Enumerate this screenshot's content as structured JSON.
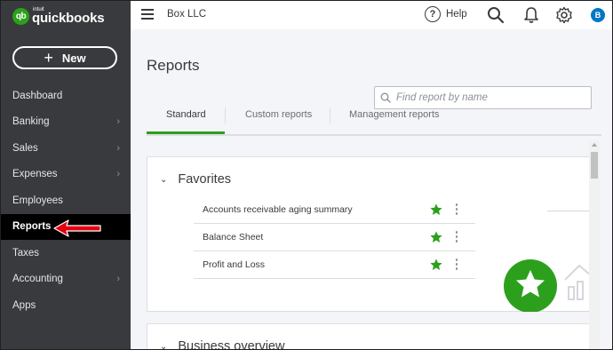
{
  "app": {
    "logo_intuit": "intuit",
    "logo_name": "quickbooks",
    "logo_mark": "qb",
    "brand_color": "#2ca01c"
  },
  "sidebar": {
    "new_button": "New",
    "items": [
      {
        "label": "Dashboard",
        "chevron": false
      },
      {
        "label": "Banking",
        "chevron": true
      },
      {
        "label": "Sales",
        "chevron": true
      },
      {
        "label": "Expenses",
        "chevron": true
      },
      {
        "label": "Employees",
        "chevron": false
      },
      {
        "label": "Reports",
        "chevron": false,
        "active": true
      },
      {
        "label": "Taxes",
        "chevron": false
      },
      {
        "label": "Accounting",
        "chevron": true
      },
      {
        "label": "Apps",
        "chevron": false
      }
    ]
  },
  "topbar": {
    "company": "Box LLC",
    "help": "Help",
    "avatar": "B"
  },
  "page": {
    "title": "Reports",
    "search_placeholder": "Find report by name",
    "tabs": [
      "Standard",
      "Custom reports",
      "Management reports"
    ],
    "active_tab": "Standard"
  },
  "favorites": {
    "heading": "Favorites",
    "rows": [
      "Accounts receivable aging summary",
      "Balance Sheet",
      "Profit and Loss"
    ]
  },
  "business_overview": {
    "heading": "Business overview"
  },
  "colors": {
    "sidebar_bg": "#393a3d",
    "active_bg": "#000000",
    "accent_green": "#2ca01c",
    "annotation_red": "#e3000f"
  }
}
